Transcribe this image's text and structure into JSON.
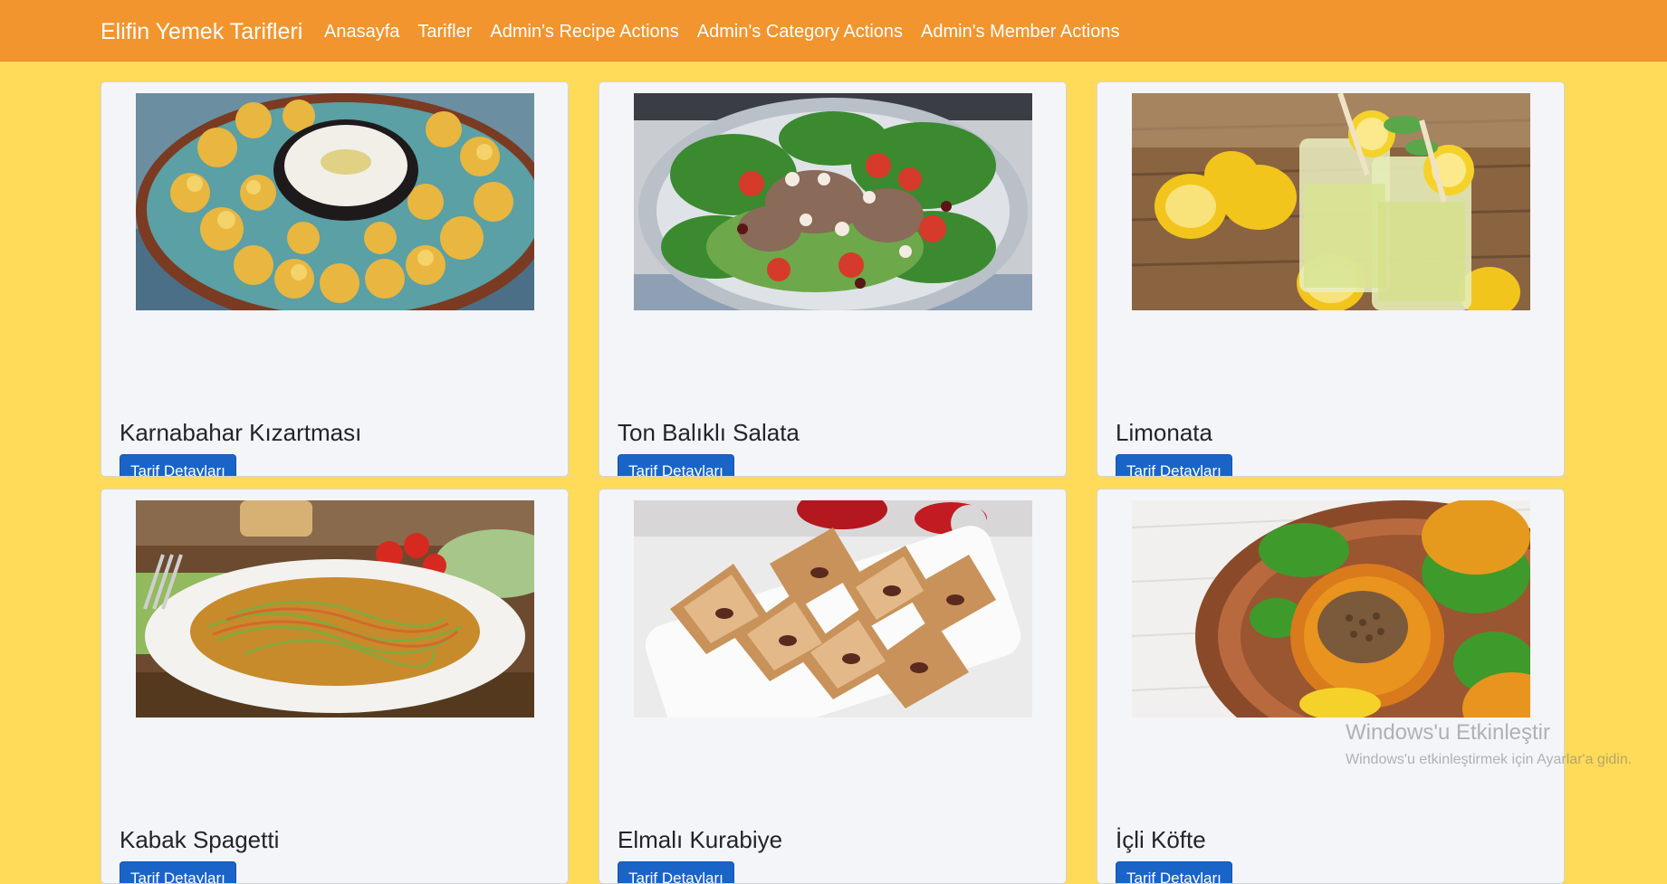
{
  "navbar": {
    "brand": "Elifin Yemek Tarifleri",
    "links": [
      {
        "label": "Anasayfa"
      },
      {
        "label": "Tarifler"
      },
      {
        "label": "Admin's Recipe Actions"
      },
      {
        "label": "Admin's Category Actions"
      },
      {
        "label": "Admin's Member Actions"
      }
    ],
    "background_color": "#f2952e"
  },
  "page": {
    "background_color": "#ffdb59"
  },
  "recipes": [
    {
      "title": "Karnabahar Kızartması",
      "button_label": "Tarif Detayları",
      "image": "fried-cauliflower-photo"
    },
    {
      "title": "Ton Balıklı Salata",
      "button_label": "Tarif Detayları",
      "image": "tuna-salad-photo"
    },
    {
      "title": "Limonata",
      "button_label": "Tarif Detayları",
      "image": "lemonade-photo"
    },
    {
      "title": "Kabak Spagetti",
      "button_label": "Tarif Detayları",
      "image": "zucchini-spaghetti-photo"
    },
    {
      "title": "Elmalı Kurabiye",
      "button_label": "Tarif Detayları",
      "image": "apple-cookies-photo"
    },
    {
      "title": "İçli Köfte",
      "button_label": "Tarif Detayları",
      "image": "stuffed-meatballs-photo"
    }
  ],
  "button_color": "#1a64c8",
  "watermark": {
    "title": "Windows'u Etkinleştir",
    "text": "Windows'u etkinleştirmek için Ayarlar'a gidin."
  }
}
